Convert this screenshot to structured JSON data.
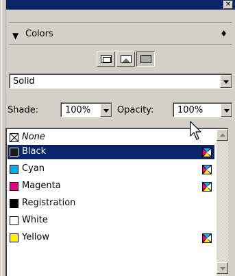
{
  "window": {
    "close_glyph": "✕"
  },
  "panel": {
    "title": "Colors",
    "collapse_icon": "triangle-down-icon",
    "menu_icon": "up-down-arrows-icon",
    "arrows_glyph": "♦"
  },
  "apply_modes": [
    {
      "name": "frame-mode",
      "icon": "frame-icon",
      "pressed": false
    },
    {
      "name": "picture-mode",
      "icon": "picture-icon",
      "pressed": false
    },
    {
      "name": "text-mode",
      "icon": "text-box-icon",
      "pressed": true
    }
  ],
  "fill_type": {
    "value": "Solid"
  },
  "shade": {
    "label": "Shade:",
    "value": "100%"
  },
  "opacity": {
    "label": "Opacity:",
    "value": "100%"
  },
  "colors": [
    {
      "label": "None",
      "swatch": "none",
      "italic": true,
      "selected": false,
      "process": false
    },
    {
      "label": "Black",
      "swatch": "#1a1a1a",
      "italic": false,
      "selected": true,
      "process": true
    },
    {
      "label": "Cyan",
      "swatch": "#00aeef",
      "italic": false,
      "selected": false,
      "process": true
    },
    {
      "label": "Magenta",
      "swatch": "#ec008c",
      "italic": false,
      "selected": false,
      "process": true
    },
    {
      "label": "Registration",
      "swatch": "#000000",
      "italic": false,
      "selected": false,
      "process": false
    },
    {
      "label": "White",
      "swatch": "#ffffff",
      "italic": false,
      "selected": false,
      "process": false
    },
    {
      "label": "Yellow",
      "swatch": "#fff200",
      "italic": false,
      "selected": false,
      "process": true
    }
  ],
  "theme": {
    "titlebar": "#0a246a",
    "selection": "#0a246a",
    "face": "#d4d0c8"
  }
}
